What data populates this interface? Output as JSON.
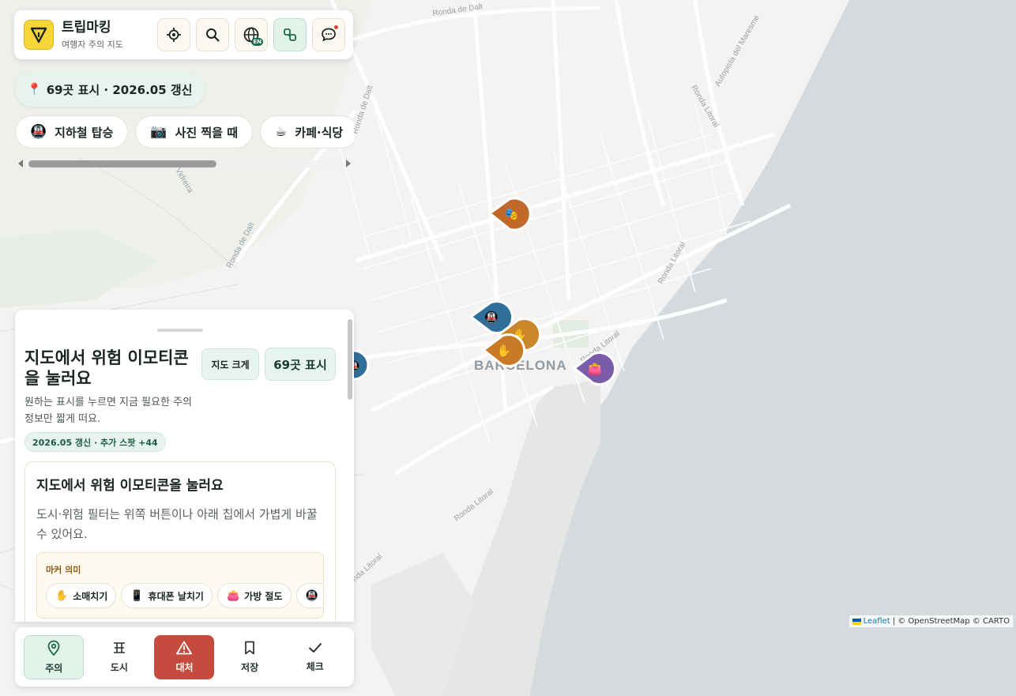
{
  "app": {
    "title": "트립마킹",
    "subtitle": "여행자 주의 지도"
  },
  "toolbar": {
    "buttons": [
      {
        "name": "locate-icon"
      },
      {
        "name": "search-icon"
      },
      {
        "name": "language-icon",
        "badge": "EN"
      },
      {
        "name": "layers-icon"
      },
      {
        "name": "chat-icon"
      }
    ]
  },
  "status": {
    "count_text": "69곳 표시 · 2026.05 갱신"
  },
  "categories": [
    {
      "emoji": "🚇",
      "label": "지하철 탑승"
    },
    {
      "emoji": "📷",
      "label": "사진 찍을 때"
    },
    {
      "emoji": "☕",
      "label": "카페·식당"
    }
  ],
  "map": {
    "city_label": "BARCELONA",
    "street_labels": [
      "Ronda de Dalt",
      "Ronda de Dalt",
      "Ronda de Dalt",
      "Ronda Litoral",
      "Ronda Litoral",
      "Ronda Litoral",
      "Ronda Litoral",
      "Autopista del Maresme",
      "Vidreira"
    ],
    "markers": [
      {
        "type": "theater",
        "emoji": "🎭",
        "color": "#c0692a"
      },
      {
        "type": "subway",
        "emoji": "🚇",
        "color": "#2f6f99"
      },
      {
        "type": "pickpocket",
        "emoji": "✋",
        "color": "#c9862a"
      },
      {
        "type": "pickpocket",
        "emoji": "✋",
        "color": "#c97a26"
      },
      {
        "type": "bag-theft",
        "emoji": "👛",
        "color": "#7b5cab"
      },
      {
        "type": "subway",
        "emoji": "🚇",
        "color": "#2f6f99"
      }
    ]
  },
  "panel": {
    "title": "지도에서 위험 이모티콘을 눌러요",
    "description": "원하는 표시를 누르면 지금 필요한 주의 정보만 짧게 떠요.",
    "map_size_label": "지도 크게",
    "count_label": "69곳 표시",
    "update_badge": "2026.05 갱신 · 추가 스팟 +44",
    "card": {
      "title": "지도에서 위험 이모티콘을 눌러요",
      "description": "도시·위험 필터는 위쪽 버튼이나 아래 칩에서 가볍게 바꿀 수 있어요."
    },
    "legend": {
      "title": "마커 의미",
      "items": [
        {
          "emoji": "✋",
          "label": "소매치기"
        },
        {
          "emoji": "📱",
          "label": "휴대폰 날치기"
        },
        {
          "emoji": "👛",
          "label": "가방 절도"
        },
        {
          "emoji": "🚇",
          "label": ""
        }
      ]
    }
  },
  "nav": {
    "items": [
      {
        "label": "주의",
        "icon": "pin-icon"
      },
      {
        "label": "도시",
        "icon": "city-icon"
      },
      {
        "label": "대처",
        "icon": "warning-icon"
      },
      {
        "label": "저장",
        "icon": "bookmark-icon"
      },
      {
        "label": "체크",
        "icon": "check-icon"
      }
    ]
  },
  "attribution": {
    "leaflet": "Leaflet",
    "rest": "| © OpenStreetMap © CARTO"
  },
  "colors": {
    "accent_green": "#1d6b4f",
    "alert_red": "#c44b3d",
    "sea": "#d4dadd",
    "land": "#f4f3f1"
  }
}
